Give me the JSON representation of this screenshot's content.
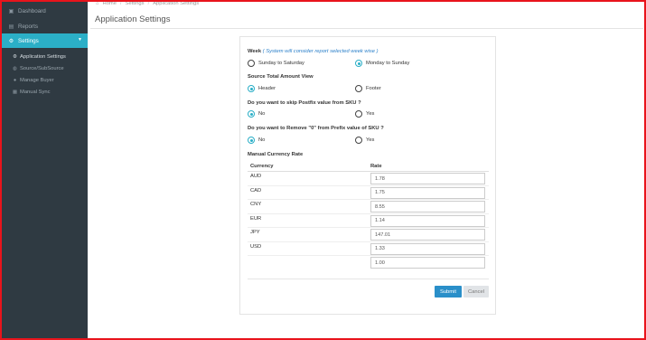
{
  "sidebar": {
    "items": [
      {
        "label": "Dashboard",
        "icon": "dashboard-icon"
      },
      {
        "label": "Reports",
        "icon": "reports-icon"
      },
      {
        "label": "Settings",
        "icon": "gears-icon"
      }
    ],
    "submenu": [
      {
        "label": "Application Settings",
        "icon": "gear-icon"
      },
      {
        "label": "Source/SubSource",
        "icon": "globe-icon"
      },
      {
        "label": "Manage Buyer",
        "icon": "user-icon"
      },
      {
        "label": "Manual Sync",
        "icon": "calendar-icon"
      }
    ]
  },
  "breadcrumb": {
    "home": "Home",
    "settings": "Settings",
    "current": "Application Settings"
  },
  "page_title": "Application Settings",
  "week": {
    "label": "Week",
    "note": "( System will consider report selected week wise )",
    "opt1": "Sunday to Saturday",
    "opt2": "Monday to Sunday",
    "selected": "Monday to Sunday"
  },
  "source_view": {
    "label": "Source Total Amount View",
    "opt1": "Header",
    "opt2": "Footer",
    "selected": "Header"
  },
  "skip_postfix": {
    "label": "Do you want to skip Postfix value from SKU ?",
    "opt1": "No",
    "opt2": "Yes",
    "selected": "No"
  },
  "remove_zero": {
    "label": "Do you want to Remove \"0\" from Prefix value of SKU ?",
    "opt1": "No",
    "opt2": "Yes",
    "selected": "No"
  },
  "currency": {
    "label": "Manual Currency Rate",
    "headers": {
      "currency": "Currency",
      "rate": "Rate"
    },
    "rows": [
      {
        "code": "AUD",
        "rate": "1.78"
      },
      {
        "code": "CAD",
        "rate": "1.75"
      },
      {
        "code": "CNY",
        "rate": "8.55"
      },
      {
        "code": "EUR",
        "rate": "1.14"
      },
      {
        "code": "JPY",
        "rate": "147.01"
      },
      {
        "code": "USD",
        "rate": "1.33"
      },
      {
        "code": "",
        "rate": "1.00"
      }
    ]
  },
  "buttons": {
    "submit": "Submit",
    "cancel": "Cancel"
  },
  "colors": {
    "accent": "#2bafc7",
    "sidebar": "#2f3a42",
    "submit": "#2a8fc9",
    "frame": "#e8141c"
  }
}
